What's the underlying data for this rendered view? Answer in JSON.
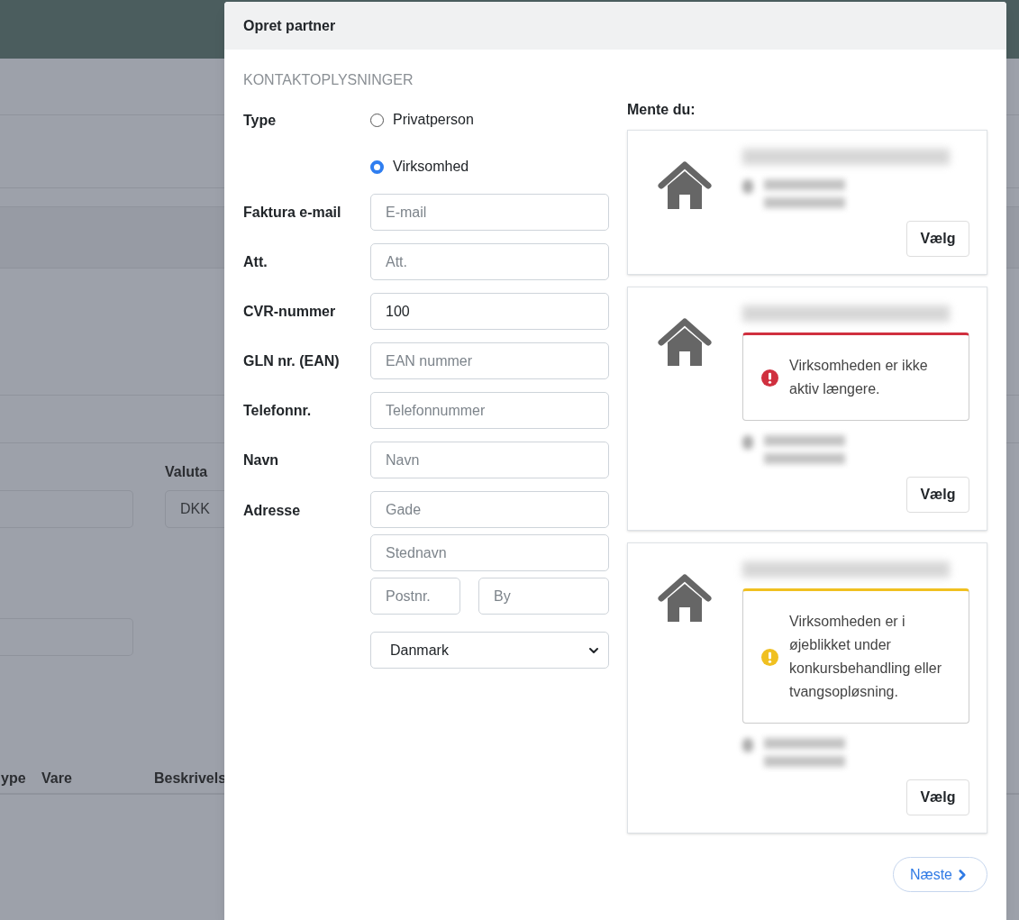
{
  "background": {
    "currency": {
      "label": "Valuta",
      "value": "DKK"
    },
    "table_columns": [
      "ype",
      "Vare",
      "Beskrivels"
    ]
  },
  "modal": {
    "title": "Opret partner",
    "section": "KONTAKTOPLYSNINGER",
    "type": {
      "label": "Type",
      "options": [
        {
          "label": "Privatperson",
          "selected": false
        },
        {
          "label": "Virksomhed",
          "selected": true
        }
      ]
    },
    "fields": [
      {
        "label": "Faktura e-mail",
        "placeholder": "E-mail"
      },
      {
        "label": "Att.",
        "placeholder": "Att."
      },
      {
        "label": "CVR-nummer",
        "value": "100"
      },
      {
        "label": "GLN nr. (EAN)",
        "placeholder": "EAN nummer"
      },
      {
        "label": "Telefonnr.",
        "placeholder": "Telefonnummer"
      },
      {
        "label": "Navn",
        "placeholder": "Navn"
      }
    ],
    "address": {
      "label": "Adresse",
      "street": {
        "placeholder": "Gade"
      },
      "place": {
        "placeholder": "Stednavn"
      },
      "postcode": {
        "placeholder": "Postnr."
      },
      "city": {
        "placeholder": "By"
      },
      "country": {
        "value": "Danmark"
      }
    },
    "suggestions": {
      "title": "Mente du:",
      "items": [
        {
          "button": "Vælg"
        },
        {
          "alert": {
            "kind": "error",
            "text": "Virksomheden er ikke aktiv længere."
          },
          "button": "Vælg"
        },
        {
          "alert": {
            "kind": "warning",
            "text": "Virksomheden er i øjeblikket under konkursbehandling eller tvangsopløsning."
          },
          "button": "Vælg"
        }
      ]
    },
    "next_button": "Næste"
  }
}
